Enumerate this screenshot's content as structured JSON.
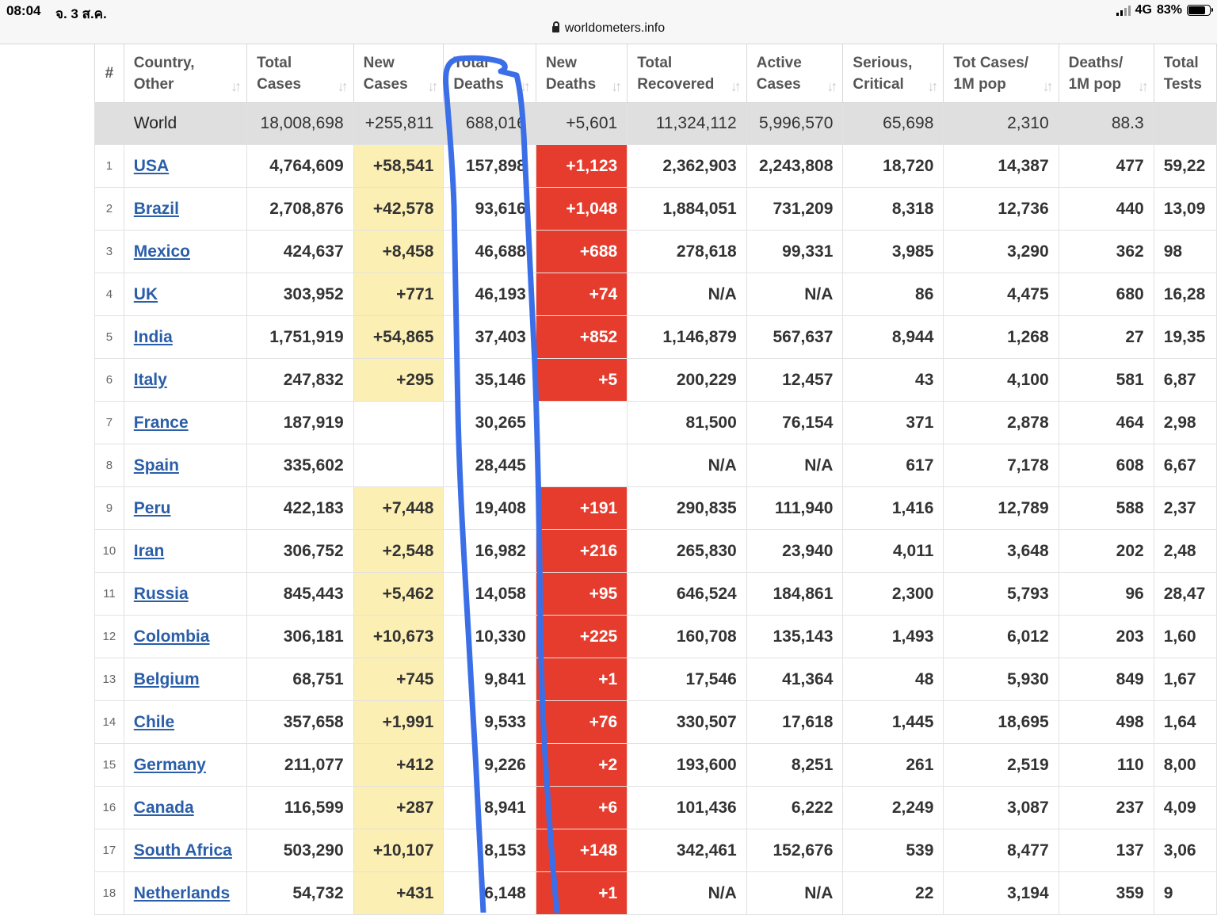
{
  "status_bar": {
    "time": "08:04",
    "date": "จ. 3 ส.ค.",
    "network": "4G",
    "battery": "83%",
    "battery_level": 0.83
  },
  "browser": {
    "url": "worldometers.info"
  },
  "table": {
    "headers": [
      {
        "line1": "#",
        "line2": ""
      },
      {
        "line1": "Country,",
        "line2": "Other"
      },
      {
        "line1": "Total",
        "line2": "Cases"
      },
      {
        "line1": "New",
        "line2": "Cases"
      },
      {
        "line1": "Total",
        "line2": "Deaths"
      },
      {
        "line1": "New",
        "line2": "Deaths"
      },
      {
        "line1": "Total",
        "line2": "Recovered"
      },
      {
        "line1": "Active",
        "line2": "Cases"
      },
      {
        "line1": "Serious,",
        "line2": "Critical"
      },
      {
        "line1": "Tot Cases/",
        "line2": "1M pop"
      },
      {
        "line1": "Deaths/",
        "line2": "1M pop"
      },
      {
        "line1": "Total",
        "line2": "Tests"
      }
    ],
    "world": {
      "country": "World",
      "total_cases": "18,008,698",
      "new_cases": "+255,811",
      "total_deaths": "688,016",
      "new_deaths": "+5,601",
      "total_recovered": "11,324,112",
      "active_cases": "5,996,570",
      "serious": "65,698",
      "cases_per_m": "2,310",
      "deaths_per_m": "88.3",
      "total_tests": ""
    },
    "rows": [
      {
        "rank": "1",
        "country": "USA",
        "total_cases": "4,764,609",
        "new_cases": "+58,541",
        "total_deaths": "157,898",
        "new_deaths": "+1,123",
        "total_recovered": "2,362,903",
        "active_cases": "2,243,808",
        "serious": "18,720",
        "cases_per_m": "14,387",
        "deaths_per_m": "477",
        "total_tests": "59,22"
      },
      {
        "rank": "2",
        "country": "Brazil",
        "total_cases": "2,708,876",
        "new_cases": "+42,578",
        "total_deaths": "93,616",
        "new_deaths": "+1,048",
        "total_recovered": "1,884,051",
        "active_cases": "731,209",
        "serious": "8,318",
        "cases_per_m": "12,736",
        "deaths_per_m": "440",
        "total_tests": "13,09"
      },
      {
        "rank": "3",
        "country": "Mexico",
        "total_cases": "424,637",
        "new_cases": "+8,458",
        "total_deaths": "46,688",
        "new_deaths": "+688",
        "total_recovered": "278,618",
        "active_cases": "99,331",
        "serious": "3,985",
        "cases_per_m": "3,290",
        "deaths_per_m": "362",
        "total_tests": "98"
      },
      {
        "rank": "4",
        "country": "UK",
        "total_cases": "303,952",
        "new_cases": "+771",
        "total_deaths": "46,193",
        "new_deaths": "+74",
        "total_recovered": "N/A",
        "active_cases": "N/A",
        "serious": "86",
        "cases_per_m": "4,475",
        "deaths_per_m": "680",
        "total_tests": "16,28"
      },
      {
        "rank": "5",
        "country": "India",
        "total_cases": "1,751,919",
        "new_cases": "+54,865",
        "total_deaths": "37,403",
        "new_deaths": "+852",
        "total_recovered": "1,146,879",
        "active_cases": "567,637",
        "serious": "8,944",
        "cases_per_m": "1,268",
        "deaths_per_m": "27",
        "total_tests": "19,35"
      },
      {
        "rank": "6",
        "country": "Italy",
        "total_cases": "247,832",
        "new_cases": "+295",
        "total_deaths": "35,146",
        "new_deaths": "+5",
        "total_recovered": "200,229",
        "active_cases": "12,457",
        "serious": "43",
        "cases_per_m": "4,100",
        "deaths_per_m": "581",
        "total_tests": "6,87"
      },
      {
        "rank": "7",
        "country": "France",
        "total_cases": "187,919",
        "new_cases": "",
        "total_deaths": "30,265",
        "new_deaths": "",
        "total_recovered": "81,500",
        "active_cases": "76,154",
        "serious": "371",
        "cases_per_m": "2,878",
        "deaths_per_m": "464",
        "total_tests": "2,98"
      },
      {
        "rank": "8",
        "country": "Spain",
        "total_cases": "335,602",
        "new_cases": "",
        "total_deaths": "28,445",
        "new_deaths": "",
        "total_recovered": "N/A",
        "active_cases": "N/A",
        "serious": "617",
        "cases_per_m": "7,178",
        "deaths_per_m": "608",
        "total_tests": "6,67"
      },
      {
        "rank": "9",
        "country": "Peru",
        "total_cases": "422,183",
        "new_cases": "+7,448",
        "total_deaths": "19,408",
        "new_deaths": "+191",
        "total_recovered": "290,835",
        "active_cases": "111,940",
        "serious": "1,416",
        "cases_per_m": "12,789",
        "deaths_per_m": "588",
        "total_tests": "2,37"
      },
      {
        "rank": "10",
        "country": "Iran",
        "total_cases": "306,752",
        "new_cases": "+2,548",
        "total_deaths": "16,982",
        "new_deaths": "+216",
        "total_recovered": "265,830",
        "active_cases": "23,940",
        "serious": "4,011",
        "cases_per_m": "3,648",
        "deaths_per_m": "202",
        "total_tests": "2,48"
      },
      {
        "rank": "11",
        "country": "Russia",
        "total_cases": "845,443",
        "new_cases": "+5,462",
        "total_deaths": "14,058",
        "new_deaths": "+95",
        "total_recovered": "646,524",
        "active_cases": "184,861",
        "serious": "2,300",
        "cases_per_m": "5,793",
        "deaths_per_m": "96",
        "total_tests": "28,47"
      },
      {
        "rank": "12",
        "country": "Colombia",
        "total_cases": "306,181",
        "new_cases": "+10,673",
        "total_deaths": "10,330",
        "new_deaths": "+225",
        "total_recovered": "160,708",
        "active_cases": "135,143",
        "serious": "1,493",
        "cases_per_m": "6,012",
        "deaths_per_m": "203",
        "total_tests": "1,60"
      },
      {
        "rank": "13",
        "country": "Belgium",
        "total_cases": "68,751",
        "new_cases": "+745",
        "total_deaths": "9,841",
        "new_deaths": "+1",
        "total_recovered": "17,546",
        "active_cases": "41,364",
        "serious": "48",
        "cases_per_m": "5,930",
        "deaths_per_m": "849",
        "total_tests": "1,67"
      },
      {
        "rank": "14",
        "country": "Chile",
        "total_cases": "357,658",
        "new_cases": "+1,991",
        "total_deaths": "9,533",
        "new_deaths": "+76",
        "total_recovered": "330,507",
        "active_cases": "17,618",
        "serious": "1,445",
        "cases_per_m": "18,695",
        "deaths_per_m": "498",
        "total_tests": "1,64"
      },
      {
        "rank": "15",
        "country": "Germany",
        "total_cases": "211,077",
        "new_cases": "+412",
        "total_deaths": "9,226",
        "new_deaths": "+2",
        "total_recovered": "193,600",
        "active_cases": "8,251",
        "serious": "261",
        "cases_per_m": "2,519",
        "deaths_per_m": "110",
        "total_tests": "8,00"
      },
      {
        "rank": "16",
        "country": "Canada",
        "total_cases": "116,599",
        "new_cases": "+287",
        "total_deaths": "8,941",
        "new_deaths": "+6",
        "total_recovered": "101,436",
        "active_cases": "6,222",
        "serious": "2,249",
        "cases_per_m": "3,087",
        "deaths_per_m": "237",
        "total_tests": "4,09"
      },
      {
        "rank": "17",
        "country": "South Africa",
        "total_cases": "503,290",
        "new_cases": "+10,107",
        "total_deaths": "8,153",
        "new_deaths": "+148",
        "total_recovered": "342,461",
        "active_cases": "152,676",
        "serious": "539",
        "cases_per_m": "8,477",
        "deaths_per_m": "137",
        "total_tests": "3,06"
      },
      {
        "rank": "18",
        "country": "Netherlands",
        "total_cases": "54,732",
        "new_cases": "+431",
        "total_deaths": "6,148",
        "new_deaths": "+1",
        "total_recovered": "N/A",
        "active_cases": "N/A",
        "serious": "22",
        "cases_per_m": "3,194",
        "deaths_per_m": "359",
        "total_tests": "9"
      }
    ]
  },
  "colors": {
    "new_cases_bg": "#fcefb3",
    "new_deaths_bg": "#e53c2d",
    "world_row_bg": "#dfdfdf",
    "link": "#2a5ea8",
    "annotation_stroke": "#3b6fe8"
  }
}
